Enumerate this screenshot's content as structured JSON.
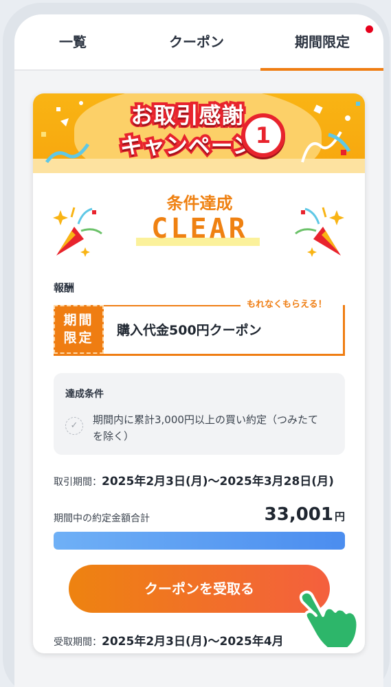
{
  "tabs": [
    {
      "label": "一覧",
      "active": false
    },
    {
      "label": "クーポン",
      "active": false
    },
    {
      "label": "期間限定",
      "active": true,
      "badge": "red-dot"
    }
  ],
  "colors": {
    "accent": "#ef7d12",
    "banner_red": "#e8232d",
    "banner_yellow": "#f9b414",
    "progress_blue": "#4b8def"
  },
  "banner": {
    "title_line1": "お取引感謝",
    "title_line2": "キャンペーン",
    "number": "1"
  },
  "status": {
    "subtitle": "条件達成",
    "word": "CLEAR"
  },
  "reward": {
    "label": "報酬",
    "note": "もれなくもらえる！",
    "badge_line1": "期間",
    "badge_line2": "限定",
    "title": "購入代金500円クーポン"
  },
  "condition": {
    "title": "達成条件",
    "text": "期間内に累計3,000円以上の買い約定（つみたてを除く）",
    "check_icon": "check-circle-icon"
  },
  "trade_period": {
    "label": "取引期間：",
    "value": "2025年2月3日(月)〜2025年3月28日(月)"
  },
  "total": {
    "label": "期間中の約定金額合計",
    "value": "33,001",
    "unit": "円",
    "progress_fraction": 1.0
  },
  "cta": {
    "label": "クーポンを受取る",
    "pointer_icon": "hand-pointer-icon"
  },
  "receive_period": {
    "label": "受取期間：",
    "value": "2025年2月3日(月)〜2025年4月"
  }
}
